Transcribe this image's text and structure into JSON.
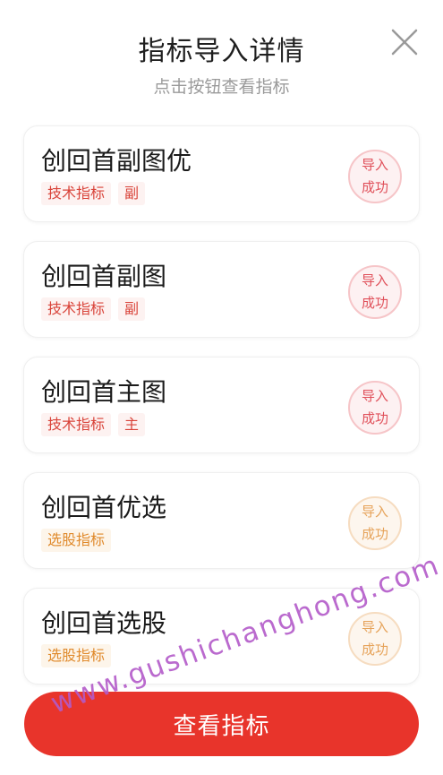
{
  "header": {
    "title": "指标导入详情",
    "subtitle": "点击按钮查看指标"
  },
  "icons": {
    "close": "close-icon"
  },
  "colors": {
    "accent_red": "#e8342b",
    "tag_red": "#d9443a",
    "tag_orange": "#e08a2c",
    "stamp_red": "#e0505a",
    "stamp_orange": "#e6a35a"
  },
  "items": [
    {
      "name": "创回首副图优",
      "tags": [
        "技术指标",
        "副"
      ],
      "tag_color": "red",
      "status_line1": "导入",
      "status_line2": "成功"
    },
    {
      "name": "创回首副图",
      "tags": [
        "技术指标",
        "副"
      ],
      "tag_color": "red",
      "status_line1": "导入",
      "status_line2": "成功"
    },
    {
      "name": "创回首主图",
      "tags": [
        "技术指标",
        "主"
      ],
      "tag_color": "red",
      "status_line1": "导入",
      "status_line2": "成功"
    },
    {
      "name": "创回首优选",
      "tags": [
        "选股指标"
      ],
      "tag_color": "orange",
      "status_line1": "导入",
      "status_line2": "成功"
    },
    {
      "name": "创回首选股",
      "tags": [
        "选股指标"
      ],
      "tag_color": "orange",
      "status_line1": "导入",
      "status_line2": "成功"
    }
  ],
  "footer": {
    "view_button_label": "查看指标"
  },
  "watermark": "www.gushichanghong.com"
}
